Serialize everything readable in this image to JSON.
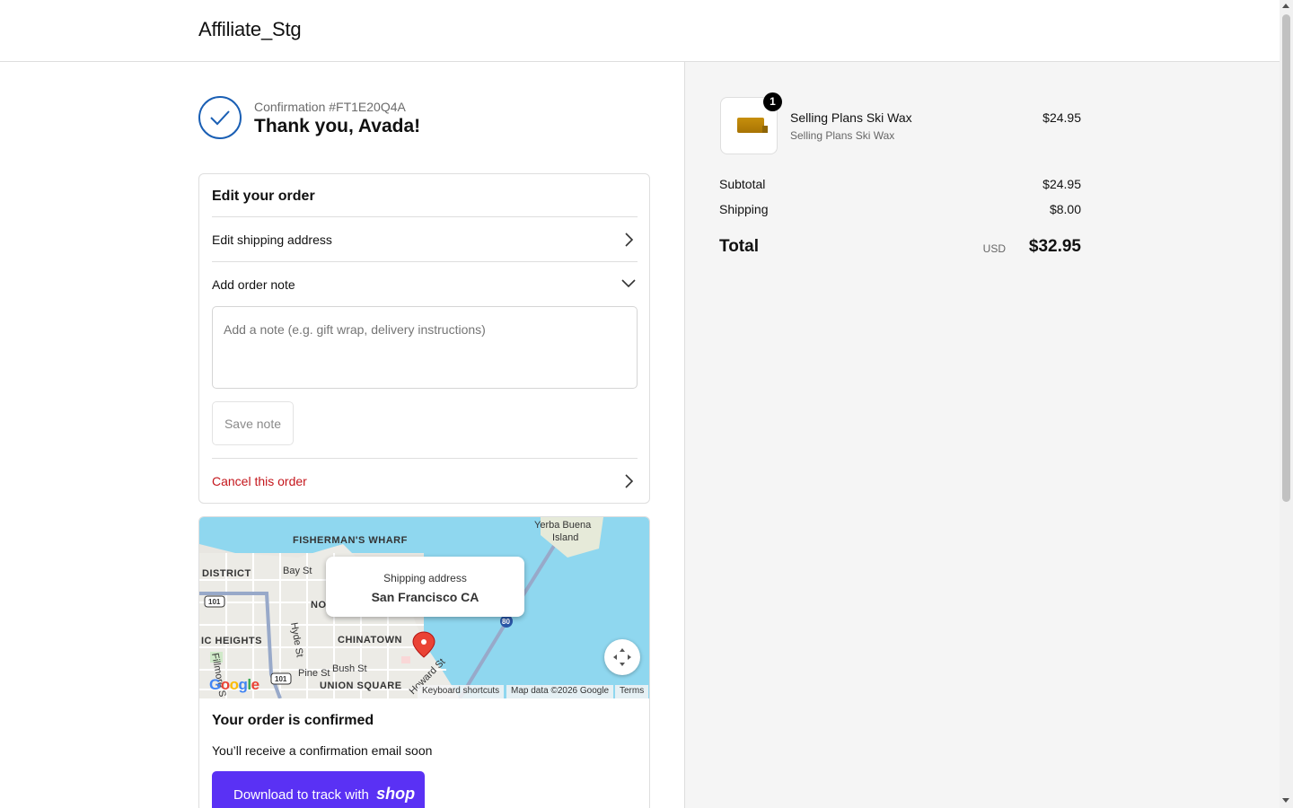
{
  "header": {
    "store_name": "Affiliate_Stg"
  },
  "confirmation": {
    "number_label": "Confirmation #FT1E20Q4A",
    "thank_you": "Thank you, Avada!",
    "icon": "checkmark-circle-icon",
    "accent_color": "#1a5fb4"
  },
  "edit_order": {
    "title": "Edit your order",
    "edit_shipping_label": "Edit shipping address",
    "add_note_label": "Add order note",
    "note_placeholder": "Add a note (e.g. gift wrap, delivery instructions)",
    "note_value": "",
    "save_note_label": "Save note",
    "cancel_label": "Cancel this order",
    "cancel_color": "#c4161c"
  },
  "map": {
    "popup_label": "Shipping address",
    "popup_value": "San Francisco CA",
    "place_labels": [
      "FISHERMAN'S WHARF",
      "Yerba Buena Island",
      "DISTRICT",
      "Bay St",
      "NO",
      "IC HEIGHTS",
      "Hyde St",
      "CHINATOWN",
      "Pine St",
      "Bush St",
      "UNION SQUARE",
      "Howard St",
      "Fillmore S",
      "101",
      "80"
    ],
    "attribution_shortcuts": "Keyboard shortcuts",
    "attribution_data": "Map data ©2026 Google",
    "attribution_terms": "Terms",
    "logo_text": "Google"
  },
  "status": {
    "title": "Your order is confirmed",
    "text": "You’ll receive a confirmation email soon",
    "shop_button_prefix": "Download to track with",
    "shop_button_brand": "shop",
    "shop_button_color": "#5a31f4"
  },
  "summary": {
    "item": {
      "name": "Selling Plans Ski Wax",
      "variant": "Selling Plans Ski Wax",
      "price": "$24.95",
      "quantity": "1"
    },
    "subtotal_label": "Subtotal",
    "subtotal_value": "$24.95",
    "shipping_label": "Shipping",
    "shipping_value": "$8.00",
    "total_label": "Total",
    "total_currency": "USD",
    "total_value": "$32.95"
  }
}
